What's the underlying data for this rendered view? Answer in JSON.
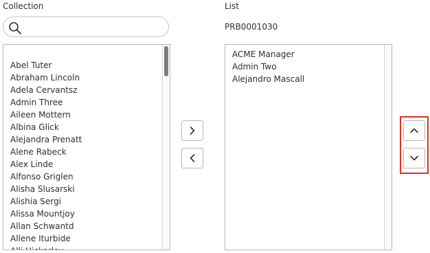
{
  "collection": {
    "heading": "Collection",
    "search": {
      "value": "",
      "placeholder": ""
    },
    "items": [
      "Abel Tuter",
      "Abraham Lincoln",
      "Adela Cervantsz",
      "Admin Three",
      "Aileen Mottern",
      "Albina Glick",
      "Alejandra Prenatt",
      "Alene Rabeck",
      "Alex Linde",
      "Alfonso Griglen",
      "Alisha Slusarski",
      "Alishia Sergi",
      "Alissa Mountjoy",
      "Allan Schwantd",
      "Allene Iturbide",
      "Alli Hickerley"
    ]
  },
  "list": {
    "heading": "List",
    "record_id": "PRB0001030",
    "items": [
      "ACME Manager",
      "Admin Two",
      "Alejandro Mascall"
    ]
  },
  "icons": {
    "search": "search-icon",
    "add": "chevron-right-icon",
    "remove": "chevron-left-icon",
    "move_up": "chevron-up-icon",
    "move_down": "chevron-down-icon"
  },
  "colors": {
    "highlight": "#e0301e",
    "border": "#b5b5b5",
    "text": "#2e2e2e"
  }
}
